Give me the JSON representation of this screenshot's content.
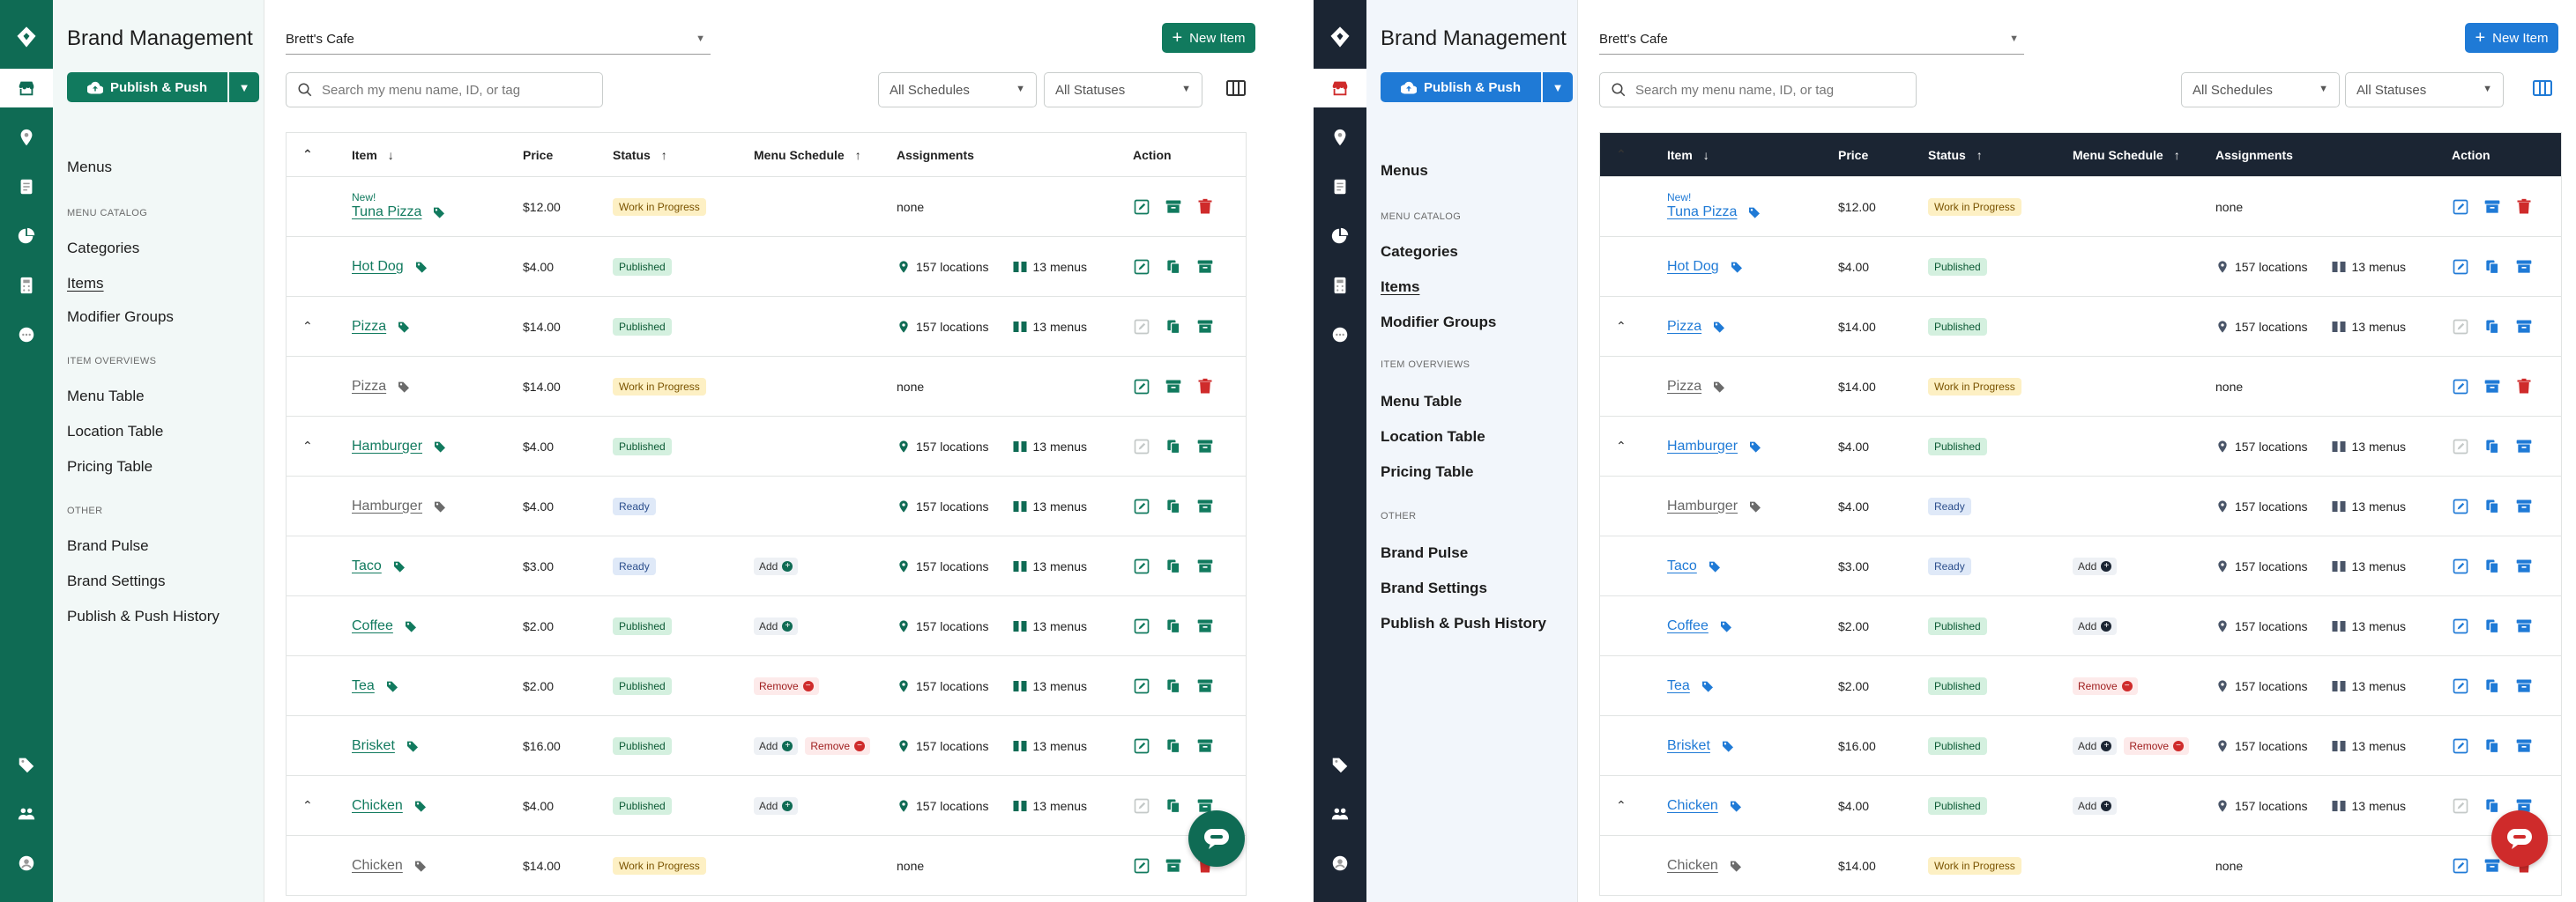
{
  "colors": {
    "green_dark": "#0f6b54",
    "green_accent": "#117a5e",
    "green_light_bg": "#f2f8f7",
    "navy_dark": "#1b2533",
    "blue_accent": "#1f7ad6",
    "blue_light_bg": "#f2f6fb",
    "red": "#cf2b2b"
  },
  "nav": {
    "brand_title": "Brand Management",
    "publish_label": "Publish & Push",
    "menus": "Menus",
    "section_catalog": "MENU CATALOG",
    "categories": "Categories",
    "items": "Items",
    "modifier_groups": "Modifier Groups",
    "section_overviews": "ITEM OVERVIEWS",
    "menu_table": "Menu Table",
    "location_table": "Location Table",
    "pricing_table": "Pricing Table",
    "section_other": "OTHER",
    "brand_pulse": "Brand Pulse",
    "brand_settings": "Brand Settings",
    "publish_history": "Publish & Push History"
  },
  "rail_icons": [
    "store-icon",
    "location-pin-icon",
    "menu-book-icon",
    "pie-chart-icon",
    "calculator-icon",
    "chat-icon",
    "tag-icon",
    "people-icon",
    "account-icon"
  ],
  "toolbar": {
    "cafe": "Brett's Cafe",
    "new_item": "New Item",
    "search_placeholder": "Search my menu name, ID, or tag",
    "schedules": "All Schedules",
    "statuses": "All Statuses"
  },
  "table": {
    "headers": {
      "item": "Item",
      "price": "Price",
      "status": "Status",
      "menu_schedule": "Menu Schedule",
      "assignments": "Assignments",
      "action": "Action"
    },
    "locations_label": "157 locations",
    "menus_label": "13 menus",
    "none_label": "none",
    "add_label": "Add",
    "remove_label": "Remove",
    "rows": [
      {
        "name": "Tuna Pizza",
        "new": "New!",
        "price": "$12.00",
        "status": "Work in Progress",
        "statusType": "wip",
        "schedule": [],
        "assign": "none",
        "parent": false,
        "child": false,
        "action": "edit-archive-delete"
      },
      {
        "name": "Hot Dog",
        "price": "$4.00",
        "status": "Published",
        "statusType": "pub",
        "schedule": [],
        "assign": "full",
        "parent": false,
        "child": false,
        "action": "edit-copy-archive"
      },
      {
        "name": "Pizza",
        "price": "$14.00",
        "status": "Published",
        "statusType": "pub",
        "schedule": [],
        "assign": "full",
        "parent": true,
        "child": false,
        "action": "disabled-copy-archive"
      },
      {
        "name": "Pizza",
        "price": "$14.00",
        "status": "Work in Progress",
        "statusType": "wip",
        "schedule": [],
        "assign": "none",
        "parent": false,
        "child": true,
        "action": "edit-archive-delete"
      },
      {
        "name": "Hamburger",
        "price": "$4.00",
        "status": "Published",
        "statusType": "pub",
        "schedule": [],
        "assign": "full",
        "parent": true,
        "child": false,
        "action": "disabled-copy-archive"
      },
      {
        "name": "Hamburger",
        "price": "$4.00",
        "status": "Ready",
        "statusType": "rdy",
        "schedule": [],
        "assign": "full",
        "parent": false,
        "child": true,
        "action": "edit-copy-archive"
      },
      {
        "name": "Taco",
        "price": "$3.00",
        "status": "Ready",
        "statusType": "rdy",
        "schedule": [
          "add"
        ],
        "assign": "full",
        "parent": false,
        "child": false,
        "action": "edit-copy-archive"
      },
      {
        "name": "Coffee",
        "price": "$2.00",
        "status": "Published",
        "statusType": "pub",
        "schedule": [
          "add"
        ],
        "assign": "full",
        "parent": false,
        "child": false,
        "action": "edit-copy-archive"
      },
      {
        "name": "Tea",
        "price": "$2.00",
        "status": "Published",
        "statusType": "pub",
        "schedule": [
          "remove"
        ],
        "assign": "full",
        "parent": false,
        "child": false,
        "action": "edit-copy-archive"
      },
      {
        "name": "Brisket",
        "price": "$16.00",
        "status": "Published",
        "statusType": "pub",
        "schedule": [
          "add",
          "remove"
        ],
        "assign": "full",
        "parent": false,
        "child": false,
        "action": "edit-copy-archive"
      },
      {
        "name": "Chicken",
        "price": "$4.00",
        "status": "Published",
        "statusType": "pub",
        "schedule": [
          "add"
        ],
        "assign": "full",
        "parent": true,
        "child": false,
        "action": "disabled-copy-archive"
      },
      {
        "name": "Chicken",
        "price": "$14.00",
        "status": "Work in Progress",
        "statusType": "wip",
        "schedule": [],
        "assign": "none",
        "parent": false,
        "child": true,
        "action": "edit-archive-delete"
      }
    ]
  }
}
